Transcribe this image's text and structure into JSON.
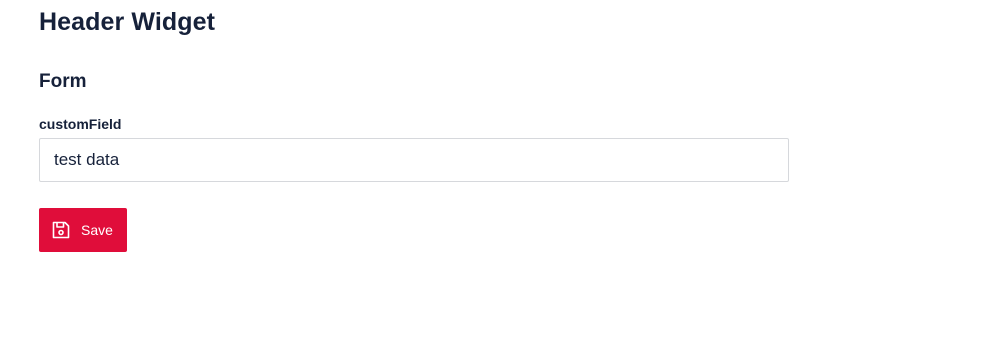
{
  "header": {
    "title": "Header Widget"
  },
  "form": {
    "title": "Form",
    "fields": [
      {
        "label": "customField",
        "value": "test data"
      }
    ],
    "save_label": "Save"
  },
  "icons": {
    "save": "floppy-disk-icon"
  },
  "colors": {
    "primary": "#e00d3a",
    "text": "#16213a",
    "border": "#d6d8dc"
  }
}
